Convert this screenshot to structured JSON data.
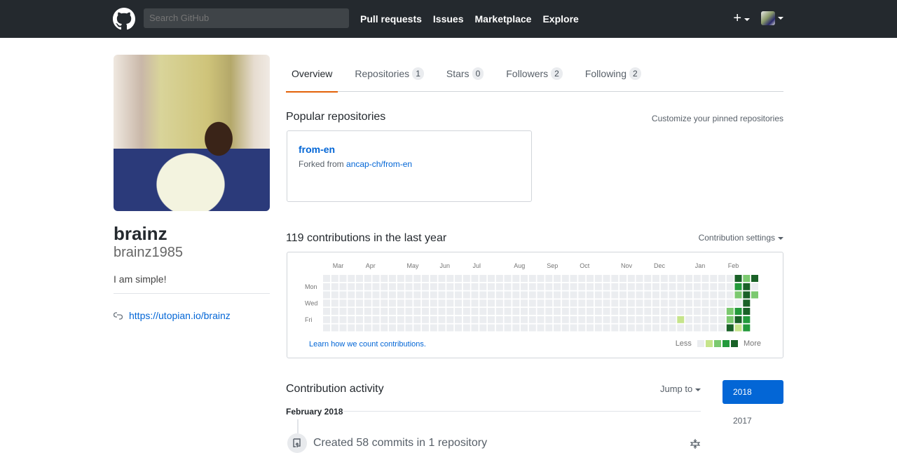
{
  "header": {
    "search_placeholder": "Search GitHub",
    "nav": [
      "Pull requests",
      "Issues",
      "Marketplace",
      "Explore"
    ],
    "plus_icon": "plus-icon",
    "logo_icon": "github-octocat-icon"
  },
  "profile": {
    "fullname": "brainz",
    "username": "brainz1985",
    "bio": "I am simple!",
    "website": "https://utopian.io/brainz",
    "website_icon": "link-icon"
  },
  "tabs": [
    {
      "label": "Overview",
      "count": null,
      "active": true
    },
    {
      "label": "Repositories",
      "count": "1",
      "active": false
    },
    {
      "label": "Stars",
      "count": "0",
      "active": false
    },
    {
      "label": "Followers",
      "count": "2",
      "active": false
    },
    {
      "label": "Following",
      "count": "2",
      "active": false
    }
  ],
  "popular": {
    "title": "Popular repositories",
    "customize_link": "Customize your pinned repositories",
    "repos": [
      {
        "name": "from-en",
        "fork_prefix": "Forked from",
        "fork_source": "ancap-ch/from-en"
      }
    ]
  },
  "contributions": {
    "title": "119 contributions in the last year",
    "settings_label": "Contribution settings",
    "learn_link": "Learn how we count contributions.",
    "legend_less": "Less",
    "legend_more": "More",
    "months": [
      {
        "label": "Mar",
        "week": 1
      },
      {
        "label": "Apr",
        "week": 5
      },
      {
        "label": "May",
        "week": 10
      },
      {
        "label": "Jun",
        "week": 14
      },
      {
        "label": "Jul",
        "week": 18
      },
      {
        "label": "Aug",
        "week": 23
      },
      {
        "label": "Sep",
        "week": 27
      },
      {
        "label": "Oct",
        "week": 31
      },
      {
        "label": "Nov",
        "week": 36
      },
      {
        "label": "Dec",
        "week": 40
      },
      {
        "label": "Jan",
        "week": 45
      },
      {
        "label": "Feb",
        "week": 49
      }
    ],
    "day_labels": [
      {
        "label": "Mon",
        "row": 1
      },
      {
        "label": "Wed",
        "row": 3
      },
      {
        "label": "Fri",
        "row": 5
      }
    ],
    "level_colors": [
      "#ebedf0",
      "#c6e48b",
      "#7bc96f",
      "#239a3b",
      "#196127"
    ],
    "weeks_total": 53,
    "last_week_days": 3,
    "nonzero_cells": [
      {
        "week": 43,
        "day": 5,
        "level": 1
      },
      {
        "week": 49,
        "day": 4,
        "level": 2
      },
      {
        "week": 49,
        "day": 5,
        "level": 2
      },
      {
        "week": 49,
        "day": 6,
        "level": 4
      },
      {
        "week": 50,
        "day": 0,
        "level": 4
      },
      {
        "week": 50,
        "day": 1,
        "level": 3
      },
      {
        "week": 50,
        "day": 2,
        "level": 2
      },
      {
        "week": 50,
        "day": 4,
        "level": 3
      },
      {
        "week": 50,
        "day": 5,
        "level": 4
      },
      {
        "week": 50,
        "day": 6,
        "level": 1
      },
      {
        "week": 51,
        "day": 0,
        "level": 2
      },
      {
        "week": 51,
        "day": 1,
        "level": 4
      },
      {
        "week": 51,
        "day": 2,
        "level": 4
      },
      {
        "week": 51,
        "day": 3,
        "level": 4
      },
      {
        "week": 51,
        "day": 4,
        "level": 4
      },
      {
        "week": 51,
        "day": 5,
        "level": 3
      },
      {
        "week": 51,
        "day": 6,
        "level": 3
      },
      {
        "week": 52,
        "day": 0,
        "level": 4
      },
      {
        "week": 52,
        "day": 2,
        "level": 2
      }
    ]
  },
  "activity": {
    "title": "Contribution activity",
    "jump_to": "Jump to",
    "years": [
      "2018",
      "2017"
    ],
    "selected_year": "2018",
    "month": "February 2018",
    "events": [
      {
        "icon": "repo-push-icon",
        "text": "Created 58 commits in 1 repository"
      }
    ],
    "fold_icon": "fold-icon"
  }
}
